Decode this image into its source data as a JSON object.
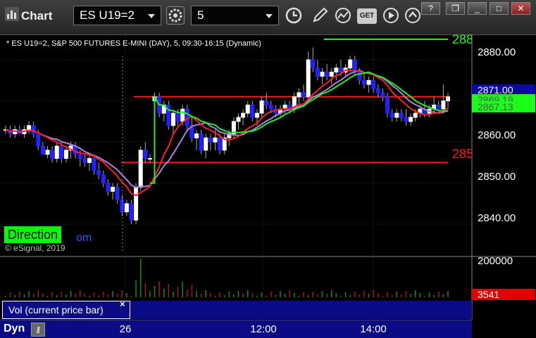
{
  "window": {
    "title": "Chart",
    "symbol_value": "ES U19=2",
    "interval_value": "5",
    "buttons": [
      "help",
      "restore",
      "minimize",
      "maximize",
      "close"
    ]
  },
  "toolbar": {
    "icons": [
      "gear-icon",
      "clock-icon",
      "pencil-icon",
      "chart-icon",
      "get-icon",
      "play-icon",
      "arrow-icon"
    ],
    "get_label": "GET"
  },
  "chart": {
    "header": "* ES U19=2, S&P 500 FUTURES E-MINI (DAY), 5, 09:30-16:15 (Dynamic)",
    "watermark": "© eSignal, 2019",
    "direction_label": "Direction",
    "direction_tail": "om",
    "level_green_label": "288",
    "level_red_label": "285",
    "colors": {
      "candle_up": "#ffffff",
      "candle_down": "#2222ff",
      "ma_red": "#ff2020",
      "ma_green": "#22ee22",
      "ma_purple": "#b080e0",
      "level_red": "#ff1a1a",
      "level_green": "#1aff1a"
    }
  },
  "price_axis": {
    "labels": [
      "2880.00",
      "2860.00",
      "2850.00",
      "2840.00"
    ],
    "current_price": "2871.00",
    "green_value_1": "2869.19",
    "green_value_2": "2867.13"
  },
  "volume": {
    "axis_label": "200000",
    "current_volume": "3541",
    "caption": "Vol (current price bar)",
    "close": "×"
  },
  "time_axis": {
    "labels": [
      "26",
      "12:00",
      "14:00"
    ],
    "dyn_label": "Dyn"
  },
  "chart_data": {
    "type": "candlestick",
    "title": "* ES U19=2, S&P 500 FUTURES E-MINI (DAY), 5, 09:30-16:15 (Dynamic)",
    "y_range": [
      2833,
      2886
    ],
    "y_ticks": [
      2880,
      2860,
      2850,
      2840
    ],
    "x_labels": [
      "26",
      "12:00",
      "14:00"
    ],
    "candles": [
      [
        2863,
        2864,
        2862,
        2863
      ],
      [
        2863,
        2864,
        2861,
        2862
      ],
      [
        2862,
        2864,
        2861,
        2863
      ],
      [
        2863,
        2864,
        2862,
        2862
      ],
      [
        2862,
        2864,
        2861,
        2863
      ],
      [
        2863,
        2865,
        2862,
        2864
      ],
      [
        2864,
        2865,
        2861,
        2862
      ],
      [
        2862,
        2863,
        2858,
        2859
      ],
      [
        2859,
        2860,
        2857,
        2857
      ],
      [
        2857,
        2859,
        2856,
        2858
      ],
      [
        2858,
        2859,
        2855,
        2856
      ],
      [
        2856,
        2860,
        2855,
        2859
      ],
      [
        2859,
        2860,
        2855,
        2856
      ],
      [
        2856,
        2859,
        2855,
        2858
      ],
      [
        2858,
        2860,
        2856,
        2859
      ],
      [
        2859,
        2860,
        2856,
        2857
      ],
      [
        2857,
        2858,
        2854,
        2856
      ],
      [
        2856,
        2857,
        2854,
        2855
      ],
      [
        2855,
        2857,
        2853,
        2856
      ],
      [
        2856,
        2857,
        2852,
        2853
      ],
      [
        2853,
        2855,
        2851,
        2852
      ],
      [
        2852,
        2853,
        2849,
        2850
      ],
      [
        2850,
        2851,
        2847,
        2848
      ],
      [
        2848,
        2850,
        2846,
        2849
      ],
      [
        2849,
        2850,
        2845,
        2846
      ],
      [
        2846,
        2847,
        2842,
        2843
      ],
      [
        2843,
        2846,
        2842,
        2845
      ],
      [
        2845,
        2846,
        2840,
        2841
      ],
      [
        2841,
        2850,
        2840,
        2849
      ],
      [
        2849,
        2859,
        2848,
        2858
      ],
      [
        2858,
        2860,
        2855,
        2856
      ],
      [
        2856,
        2857,
        2855,
        2856
      ],
      [
        2870,
        2872,
        2868,
        2871
      ],
      [
        2871,
        2872,
        2866,
        2867
      ],
      [
        2867,
        2870,
        2865,
        2869
      ],
      [
        2869,
        2870,
        2863,
        2864
      ],
      [
        2864,
        2868,
        2862,
        2867
      ],
      [
        2867,
        2868,
        2864,
        2865
      ],
      [
        2865,
        2869,
        2864,
        2868
      ],
      [
        2868,
        2869,
        2863,
        2864
      ],
      [
        2864,
        2866,
        2860,
        2861
      ],
      [
        2861,
        2863,
        2858,
        2862
      ],
      [
        2862,
        2863,
        2857,
        2858
      ],
      [
        2858,
        2862,
        2856,
        2861
      ],
      [
        2861,
        2862,
        2858,
        2860
      ],
      [
        2860,
        2863,
        2858,
        2861
      ],
      [
        2861,
        2862,
        2857,
        2858
      ],
      [
        2858,
        2862,
        2857,
        2861
      ],
      [
        2861,
        2863,
        2859,
        2862
      ],
      [
        2862,
        2866,
        2861,
        2865
      ],
      [
        2865,
        2867,
        2863,
        2866
      ],
      [
        2866,
        2868,
        2864,
        2867
      ],
      [
        2867,
        2870,
        2866,
        2869
      ],
      [
        2869,
        2870,
        2865,
        2866
      ],
      [
        2866,
        2868,
        2864,
        2867
      ],
      [
        2867,
        2871,
        2866,
        2870
      ],
      [
        2870,
        2872,
        2868,
        2869
      ],
      [
        2869,
        2870,
        2867,
        2868
      ],
      [
        2868,
        2869,
        2866,
        2867
      ],
      [
        2867,
        2869,
        2866,
        2868
      ],
      [
        2868,
        2870,
        2867,
        2869
      ],
      [
        2869,
        2870,
        2867,
        2868
      ],
      [
        2868,
        2872,
        2867,
        2871
      ],
      [
        2871,
        2873,
        2869,
        2872
      ],
      [
        2872,
        2874,
        2870,
        2871
      ],
      [
        2871,
        2882,
        2870,
        2880
      ],
      [
        2880,
        2883,
        2877,
        2878
      ],
      [
        2878,
        2880,
        2875,
        2876
      ],
      [
        2876,
        2878,
        2874,
        2877
      ],
      [
        2877,
        2879,
        2875,
        2876
      ],
      [
        2876,
        2878,
        2874,
        2877
      ],
      [
        2877,
        2879,
        2875,
        2878
      ],
      [
        2878,
        2880,
        2876,
        2877
      ],
      [
        2877,
        2879,
        2876,
        2878
      ],
      [
        2878,
        2881,
        2877,
        2880
      ],
      [
        2880,
        2881,
        2876,
        2877
      ],
      [
        2877,
        2878,
        2874,
        2875
      ],
      [
        2875,
        2877,
        2873,
        2874
      ],
      [
        2874,
        2876,
        2872,
        2875
      ],
      [
        2875,
        2876,
        2872,
        2873
      ],
      [
        2873,
        2874,
        2871,
        2872
      ],
      [
        2872,
        2873,
        2870,
        2871
      ],
      [
        2871,
        2872,
        2866,
        2867
      ],
      [
        2867,
        2868,
        2865,
        2866
      ],
      [
        2866,
        2868,
        2865,
        2867
      ],
      [
        2867,
        2868,
        2865,
        2866
      ],
      [
        2866,
        2868,
        2864,
        2865
      ],
      [
        2865,
        2867,
        2864,
        2866
      ],
      [
        2866,
        2868,
        2865,
        2867
      ],
      [
        2867,
        2869,
        2866,
        2868
      ],
      [
        2868,
        2870,
        2866,
        2867
      ],
      [
        2867,
        2869,
        2866,
        2868
      ],
      [
        2868,
        2871,
        2867,
        2869
      ],
      [
        2869,
        2870,
        2867,
        2868
      ],
      [
        2868,
        2874,
        2867,
        2870
      ],
      [
        2870,
        2872,
        2868,
        2871
      ]
    ],
    "levels": [
      {
        "value": 2885,
        "color": "green",
        "label": "288"
      },
      {
        "value": 2871,
        "color": "red"
      },
      {
        "value": 2855,
        "color": "red",
        "label": "285"
      }
    ]
  }
}
